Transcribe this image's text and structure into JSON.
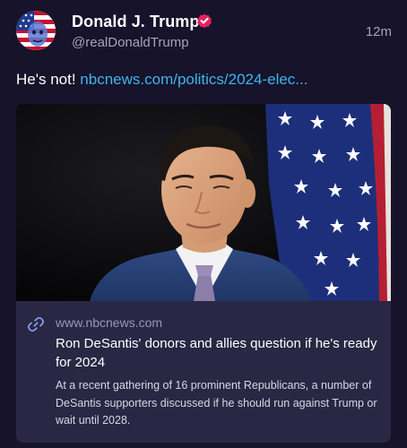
{
  "author": {
    "display_name": "Donald J. Trump",
    "handle": "@realDonaldTrump",
    "verified": true,
    "avatar_icon": "flag-face-avatar"
  },
  "timestamp": "12m",
  "post": {
    "text": "He's not!",
    "link_text": "nbcnews.com/politics/2024-elec..."
  },
  "link_card": {
    "image_alt": "Ron DeSantis in front of an American flag",
    "domain": "www.nbcnews.com",
    "title": "Ron DeSantis' donors and allies question if he's ready for 2024",
    "description": "At a recent gathering of 16 prominent Republicans, a number of DeSantis supporters discussed if he should run against Trump or wait until 2028."
  },
  "colors": {
    "background": "#16132b",
    "card_background": "#2a2744",
    "link": "#3fb5ee",
    "verified_badge": "#e0245e",
    "secondary_text": "#a6a3bd"
  }
}
